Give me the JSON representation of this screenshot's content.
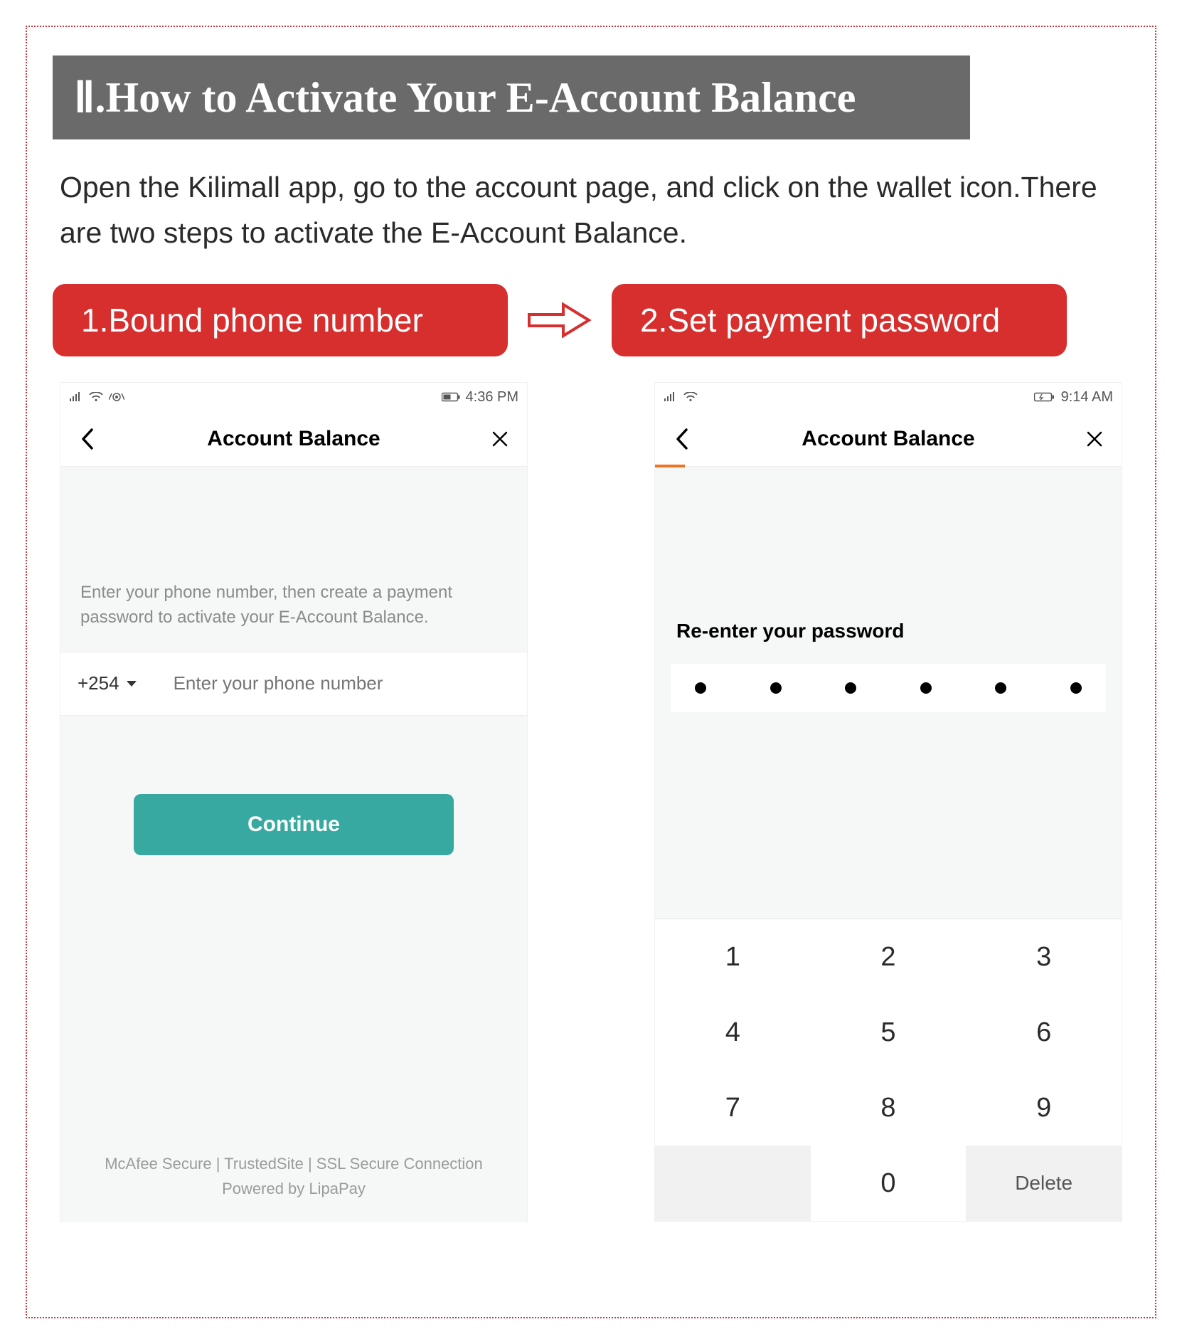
{
  "section_heading": "Ⅱ.How to Activate Your E-Account Balance",
  "intro_text": "Open the Kilimall app, go to the account page, and click on the wallet icon.There are two steps to activate the E-Account Balance.",
  "step1": {
    "label": "1.Bound phone number"
  },
  "step2": {
    "label": "2.Set payment password"
  },
  "screen1": {
    "status_time": "4:36 PM",
    "nav_title": "Account Balance",
    "instruction": "Enter your phone number, then create a payment password to activate your E-Account Balance.",
    "country_code": "+254",
    "phone_placeholder": "Enter your phone number",
    "continue_label": "Continue",
    "footer_line1": "McAfee Secure | TrustedSite | SSL Secure Connection",
    "footer_line2": "Powered by LipaPay"
  },
  "screen2": {
    "status_time": "9:14 AM",
    "nav_title": "Account Balance",
    "prompt": "Re-enter your password",
    "dots_count": 6,
    "keys": [
      "1",
      "2",
      "3",
      "4",
      "5",
      "6",
      "7",
      "8",
      "9",
      "",
      "0",
      "Delete"
    ]
  }
}
